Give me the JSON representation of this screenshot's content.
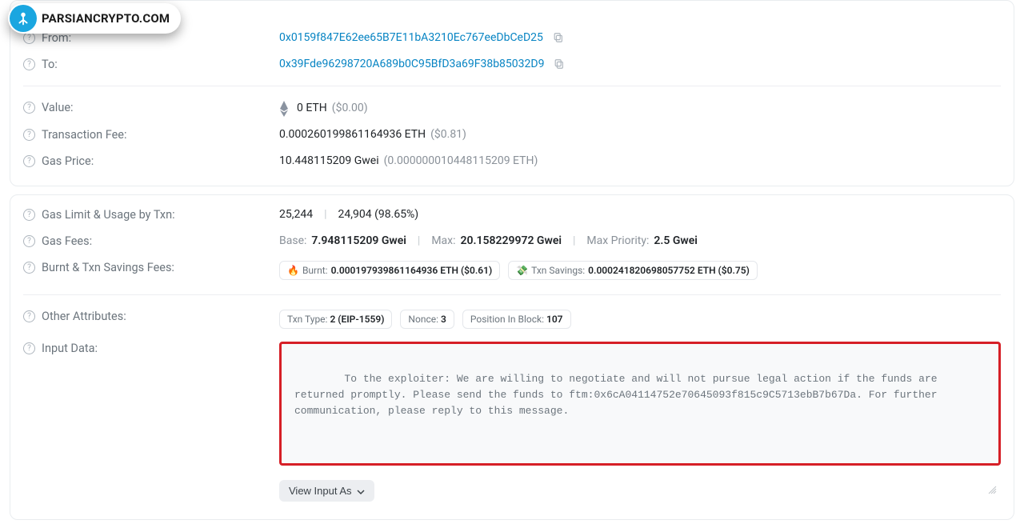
{
  "brand": "PARSIANCRYPTO.COM",
  "card1": {
    "from": {
      "label": "From:",
      "value": "0x0159f847E62ee65B7E11bA3210Ec767eeDbCeD25"
    },
    "to": {
      "label": "To:",
      "value": "0x39Fde96298720A689b0C95BfD3a69F38b85032D9"
    },
    "value": {
      "label": "Value:",
      "amount": "0 ETH",
      "usd": "($0.00)"
    },
    "fee": {
      "label": "Transaction Fee:",
      "amount": "0.000260199861164936 ETH",
      "usd": "($0.81)"
    },
    "gas_price": {
      "label": "Gas Price:",
      "gwei": "10.448115209 Gwei",
      "eth": "(0.000000010448115209 ETH)"
    }
  },
  "card2": {
    "gas_limit": {
      "label": "Gas Limit & Usage by Txn:",
      "limit": "25,244",
      "used": "24,904 (98.65%)"
    },
    "gas_fees": {
      "label": "Gas Fees:",
      "base_label": "Base:",
      "base_val": "7.948115209 Gwei",
      "max_label": "Max:",
      "max_val": "20.158229972 Gwei",
      "maxp_label": "Max Priority:",
      "maxp_val": "2.5 Gwei"
    },
    "burnt": {
      "label": "Burnt & Txn Savings Fees:",
      "burnt_label": "Burnt:",
      "burnt_val": "0.000197939861164936 ETH ($0.61)",
      "save_label": "Txn Savings:",
      "save_val": "0.000241820698057752 ETH ($0.75)"
    },
    "attrs": {
      "label": "Other Attributes:",
      "txn_type_label": "Txn Type:",
      "txn_type_val": "2 (EIP-1559)",
      "nonce_label": "Nonce:",
      "nonce_val": "3",
      "pos_label": "Position In Block:",
      "pos_val": "107"
    },
    "input": {
      "label": "Input Data:",
      "text": "To the exploiter: We are willing to negotiate and will not pursue legal action if the funds are returned promptly. Please send the funds to ftm:0x6cA04114752e70645093f815c9C5713ebB7b67Da. For further communication, please reply to this message.",
      "view_btn": "View Input As"
    }
  }
}
